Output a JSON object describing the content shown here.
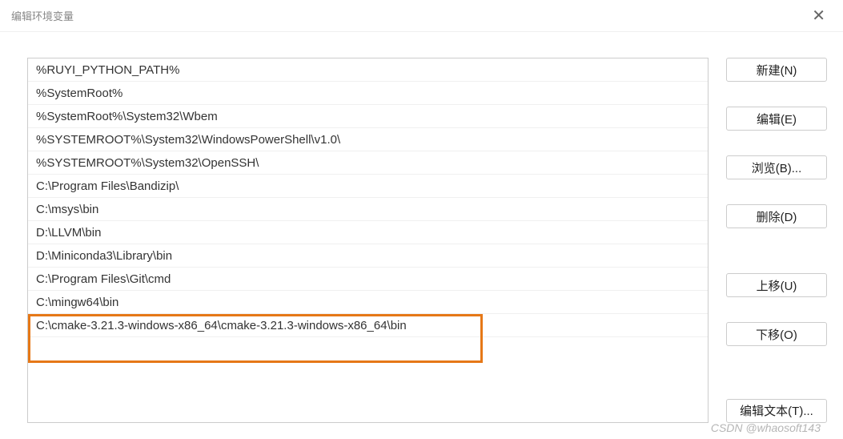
{
  "window": {
    "title": "编辑环境变量"
  },
  "paths": [
    "%RUYI_PYTHON_PATH%",
    "%SystemRoot%",
    "%SystemRoot%\\System32\\Wbem",
    "%SYSTEMROOT%\\System32\\WindowsPowerShell\\v1.0\\",
    "%SYSTEMROOT%\\System32\\OpenSSH\\",
    "C:\\Program Files\\Bandizip\\",
    "C:\\msys\\bin",
    "D:\\LLVM\\bin",
    "D:\\Miniconda3\\Library\\bin",
    "C:\\Program Files\\Git\\cmd",
    "C:\\mingw64\\bin",
    "C:\\cmake-3.21.3-windows-x86_64\\cmake-3.21.3-windows-x86_64\\bin"
  ],
  "buttons": {
    "new": "新建(N)",
    "edit": "编辑(E)",
    "browse": "浏览(B)...",
    "delete": "删除(D)",
    "moveUp": "上移(U)",
    "moveDown": "下移(O)",
    "editText": "编辑文本(T)..."
  },
  "watermark": "CSDN @whaosoft143"
}
